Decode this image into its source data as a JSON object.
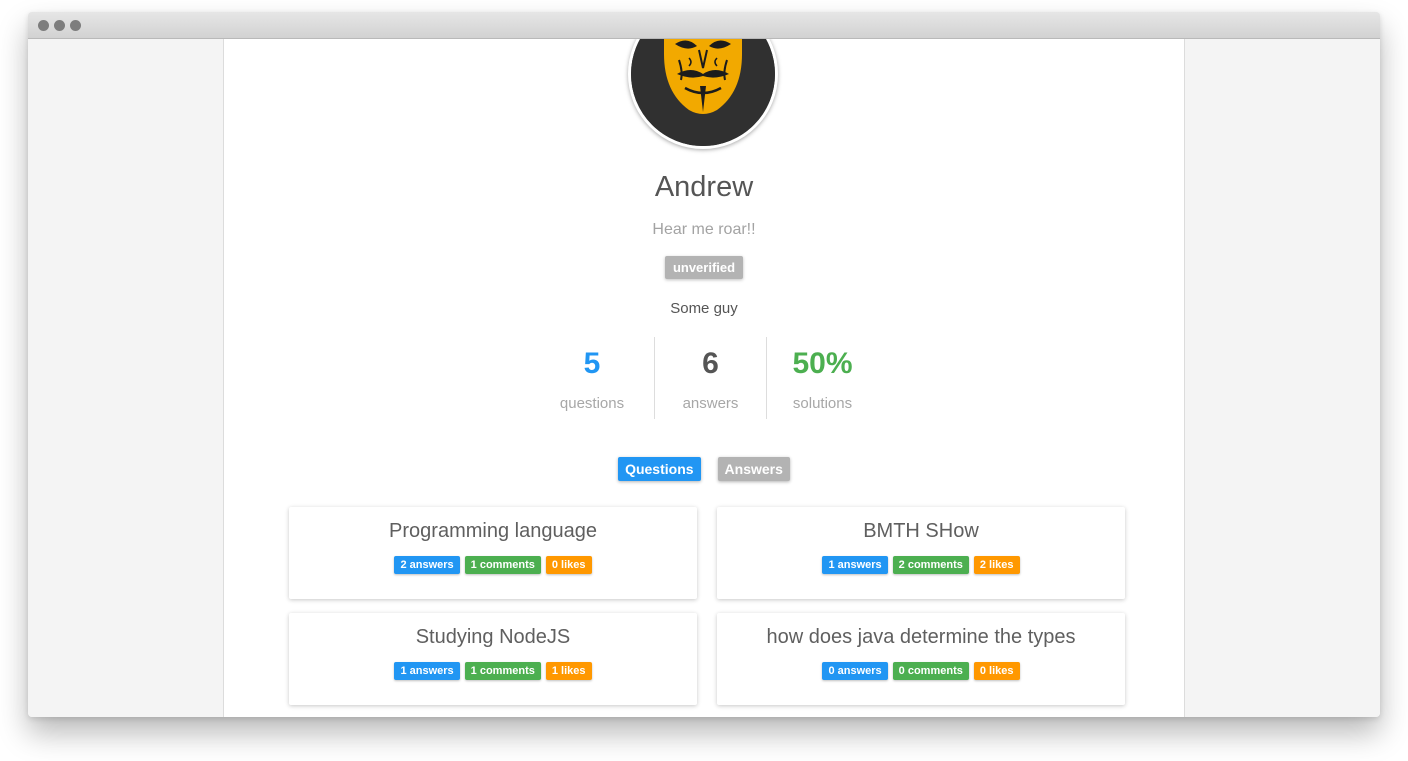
{
  "profile": {
    "name": "Andrew",
    "tagline": "Hear me roar!!",
    "status": "unverified",
    "bio": "Some guy"
  },
  "stats": [
    {
      "value": "5",
      "label": "questions",
      "color": "#2196f3"
    },
    {
      "value": "6",
      "label": "answers",
      "color": "#555555"
    },
    {
      "value": "50%",
      "label": "solutions",
      "color": "#4caf50"
    }
  ],
  "tabs": [
    {
      "label": "Questions",
      "active": true
    },
    {
      "label": "Answers",
      "active": false
    }
  ],
  "questions": [
    {
      "title": "Programming language",
      "answers": "2 answers",
      "comments": "1 comments",
      "likes": "0 likes"
    },
    {
      "title": "BMTH SHow",
      "answers": "1 answers",
      "comments": "2 comments",
      "likes": "2 likes"
    },
    {
      "title": "Studying NodeJS",
      "answers": "1 answers",
      "comments": "1 comments",
      "likes": "1 likes"
    },
    {
      "title": "how does java determine the types",
      "answers": "0 answers",
      "comments": "0 comments",
      "likes": "0 likes"
    }
  ],
  "colors": {
    "primary": "#2196f3",
    "success": "#4caf50",
    "warning": "#ff9800",
    "muted": "#b3b3b3"
  },
  "icons": {
    "avatar": "mask-avatar-icon"
  }
}
